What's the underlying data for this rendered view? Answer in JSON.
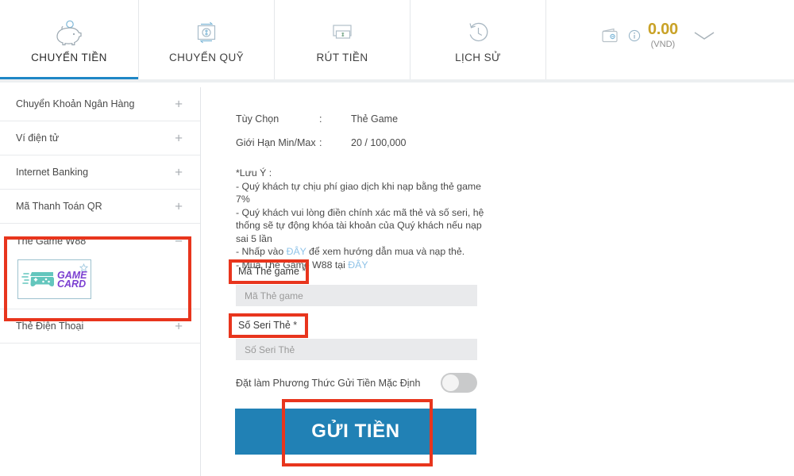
{
  "header": {
    "tabs": [
      {
        "label": "CHUYỂN TIỀN",
        "icon": "piggy-bank-icon",
        "active": true
      },
      {
        "label": "CHUYỂN QUỸ",
        "icon": "transfer-funds-icon",
        "active": false
      },
      {
        "label": "RÚT TIỀN",
        "icon": "withdraw-cash-icon",
        "active": false
      },
      {
        "label": "LỊCH SỬ",
        "icon": "history-clock-icon",
        "active": false
      }
    ],
    "wallet": {
      "icon": "wallet-icon",
      "info_icon": "info-icon",
      "balance": "0.00",
      "currency": "(VND)",
      "caret_icon": "chevron-down-icon",
      "balance_color": "#c9a227"
    }
  },
  "sidebar": {
    "items": [
      {
        "label": "Chuyển Khoản Ngân Hàng",
        "sign": "+"
      },
      {
        "label": "Ví điện tử",
        "sign": "+"
      },
      {
        "label": "Internet Banking",
        "sign": "+"
      },
      {
        "label": "Mã Thanh Toán QR",
        "sign": "+"
      },
      {
        "label": "Thẻ Game W88",
        "sign": "−"
      },
      {
        "label": "Thẻ Điện Thoại",
        "sign": "+"
      }
    ],
    "card": {
      "name": "GAME CARD",
      "word_top": "GAME",
      "word_bottom": "CARD",
      "star_icon": "favorite-star-icon",
      "logo_color": "#7b3fd1",
      "pad_color": "#63c6bd"
    }
  },
  "main": {
    "info": [
      {
        "key": "Tùy Chọn",
        "colon": ":",
        "value": "Thẻ Game"
      },
      {
        "key": "Giới Hạn Min/Max",
        "colon": ":",
        "value": "20 / 100,000"
      }
    ],
    "note": {
      "title": "*Lưu Ý :",
      "line1": "- Quý khách tự chịu phí giao dịch khi nạp bằng thẻ game 7%",
      "line2": "- Quý khách vui lòng điền chính xác mã thẻ và số seri, hệ thống sẽ tự động khóa tài khoản của Quý khách nếu nạp sai 5 lần",
      "line3_pre": "- Nhấp vào ",
      "line3_link": "ĐÂY",
      "line3_post": " để xem hướng dẫn mua và nạp thẻ.",
      "line4_pre": "- Mua Thẻ Game W88 tại ",
      "line4_link": "ĐÂY",
      "link_color": "#8fc3e8"
    },
    "fields": [
      {
        "label": "Mã Thẻ game",
        "required_mark": "*",
        "placeholder": "Mã Thẻ game",
        "value": ""
      },
      {
        "label": "Số Seri Thẻ",
        "required_mark": "*",
        "placeholder": "Số Seri Thẻ",
        "value": ""
      }
    ],
    "toggle": {
      "label": "Đặt làm Phương Thức Gửi Tiền Mặc Định",
      "state": "off"
    },
    "submit": {
      "label": "GỬI TIỀN",
      "color": "#2181b5"
    }
  },
  "annotations": {
    "highlight_color": "#e8351d",
    "boxes": [
      {
        "name": "highlight-sidebar-game-card"
      },
      {
        "name": "highlight-card-code-label"
      },
      {
        "name": "highlight-serial-label"
      },
      {
        "name": "highlight-submit-button"
      }
    ]
  }
}
